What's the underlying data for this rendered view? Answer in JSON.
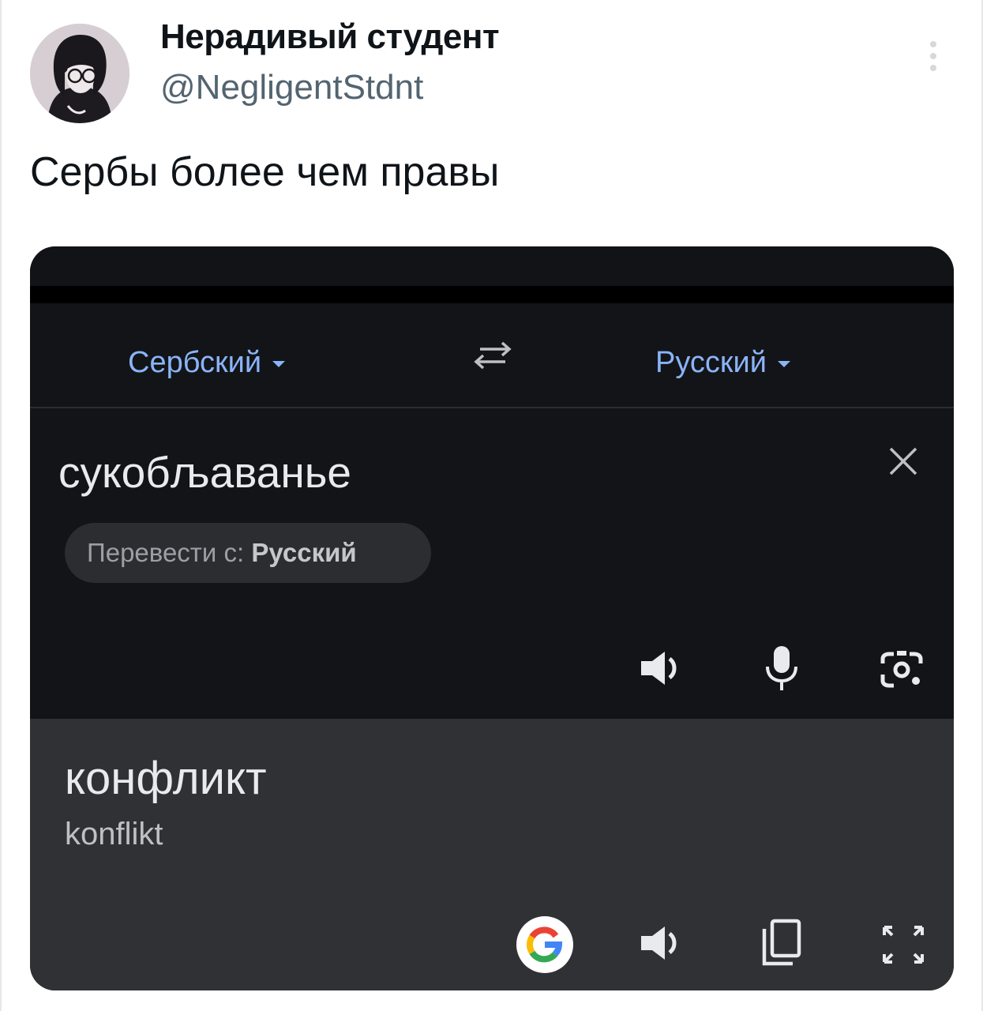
{
  "tweet": {
    "author_name": "Нерадивый студент",
    "author_handle": "@NegligentStdnt",
    "text": "Сербы более чем правы"
  },
  "translator": {
    "source_language": "Сербский",
    "target_language": "Русский",
    "input_text": "сукобљаванье",
    "detect_prefix": "Перевести с:",
    "detect_language": "Русский",
    "result_text": "конфликт",
    "transliteration": "konflikt"
  },
  "icons": {
    "more": "more-vertical-icon",
    "swap": "swap-languages-icon",
    "clear": "close-icon",
    "speaker": "speaker-icon",
    "mic": "microphone-icon",
    "camera": "lens-camera-icon",
    "google": "google-logo-icon",
    "copy": "copy-icon",
    "expand": "fullscreen-icon"
  },
  "colors": {
    "accent_blue": "#8ab4f8",
    "panel_dark": "#131418",
    "result_panel": "#303134",
    "text_light": "#e8eaed",
    "google_blue": "#4285F4",
    "google_red": "#EA4335",
    "google_yellow": "#FBBC05",
    "google_green": "#34A853"
  }
}
